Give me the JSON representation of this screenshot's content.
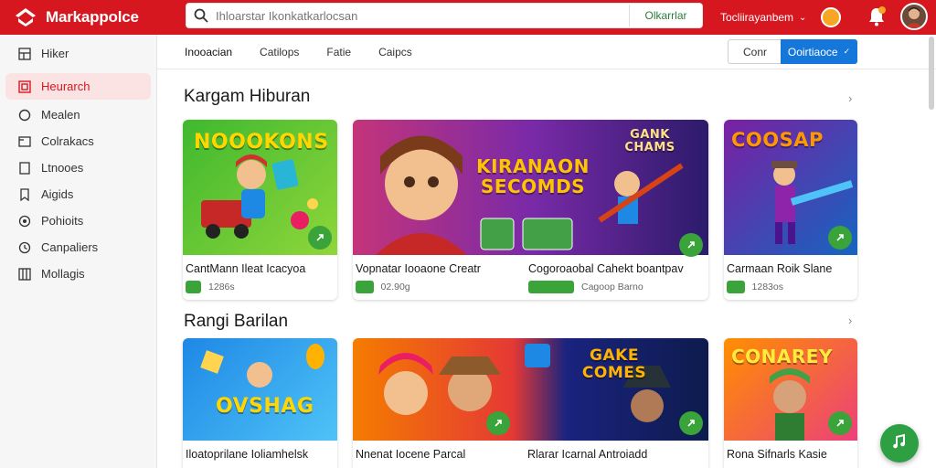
{
  "app": {
    "name": "Markappolce"
  },
  "search": {
    "placeholder": "Ihloarstar Ikonkatkarlocsan",
    "filter_label": "Olkarrlar"
  },
  "account": {
    "label": "Tocliirayanbem"
  },
  "sidebar": {
    "items": [
      {
        "label": "Hiker",
        "icon": "grid-icon"
      },
      {
        "label": "Heurarch",
        "icon": "store-icon",
        "active": true
      },
      {
        "label": "Mealen",
        "icon": "circle-icon"
      },
      {
        "label": "Colrakacs",
        "icon": "folder-icon"
      },
      {
        "label": "Ltnooes",
        "icon": "square-icon"
      },
      {
        "label": "Aigids",
        "icon": "bookmark-icon"
      },
      {
        "label": "Pohioits",
        "icon": "target-icon"
      },
      {
        "label": "Canpaliers",
        "icon": "clock-icon"
      },
      {
        "label": "Mollagis",
        "icon": "grid-icon"
      }
    ]
  },
  "tabs": [
    "Inooacian",
    "Catilops",
    "Fatie",
    "Caipcs"
  ],
  "actions": {
    "secondary": "Conr",
    "primary": "Ooirtiaoce"
  },
  "sections": [
    {
      "title": "Kargam Hiburan",
      "cards": [
        {
          "art_text": "NOOOKONS",
          "title": "CantMann Ileat Icacyoa",
          "badge": "",
          "meta": "1286s"
        },
        {
          "art_text": "KIRANAON SECOMDS",
          "art_text_top": "GANK CHAMS",
          "title": "Vopnatar Iooaone Creatr",
          "badge": "",
          "meta": "02.90g"
        },
        {
          "art_text": "",
          "title": "Cogoroaobal Cahekt boantpav",
          "badge": "",
          "meta": "Cagoop Barno"
        },
        {
          "art_text": "COOSAP",
          "title": "Carmaan Roik Slane",
          "badge": "",
          "meta": "1283os"
        }
      ]
    },
    {
      "title": "Rangi Barilan",
      "cards": [
        {
          "art_text": "OVSHAG",
          "title": "Iloatoprilane Ioliamhelsk",
          "meta": ""
        },
        {
          "art_text": "",
          "title": "Nnenat Iocene Parcal",
          "meta": ""
        },
        {
          "art_text": "GAKE COMES",
          "title": "Rlarar Icarnal Antroiadd",
          "meta": ""
        },
        {
          "art_text": "CONAREY",
          "title": "Rona Sifnarls Kasie",
          "meta": ""
        }
      ]
    }
  ],
  "colors": {
    "brand": "#d7171f",
    "accent": "#1577d9",
    "success": "#3aa33a"
  }
}
